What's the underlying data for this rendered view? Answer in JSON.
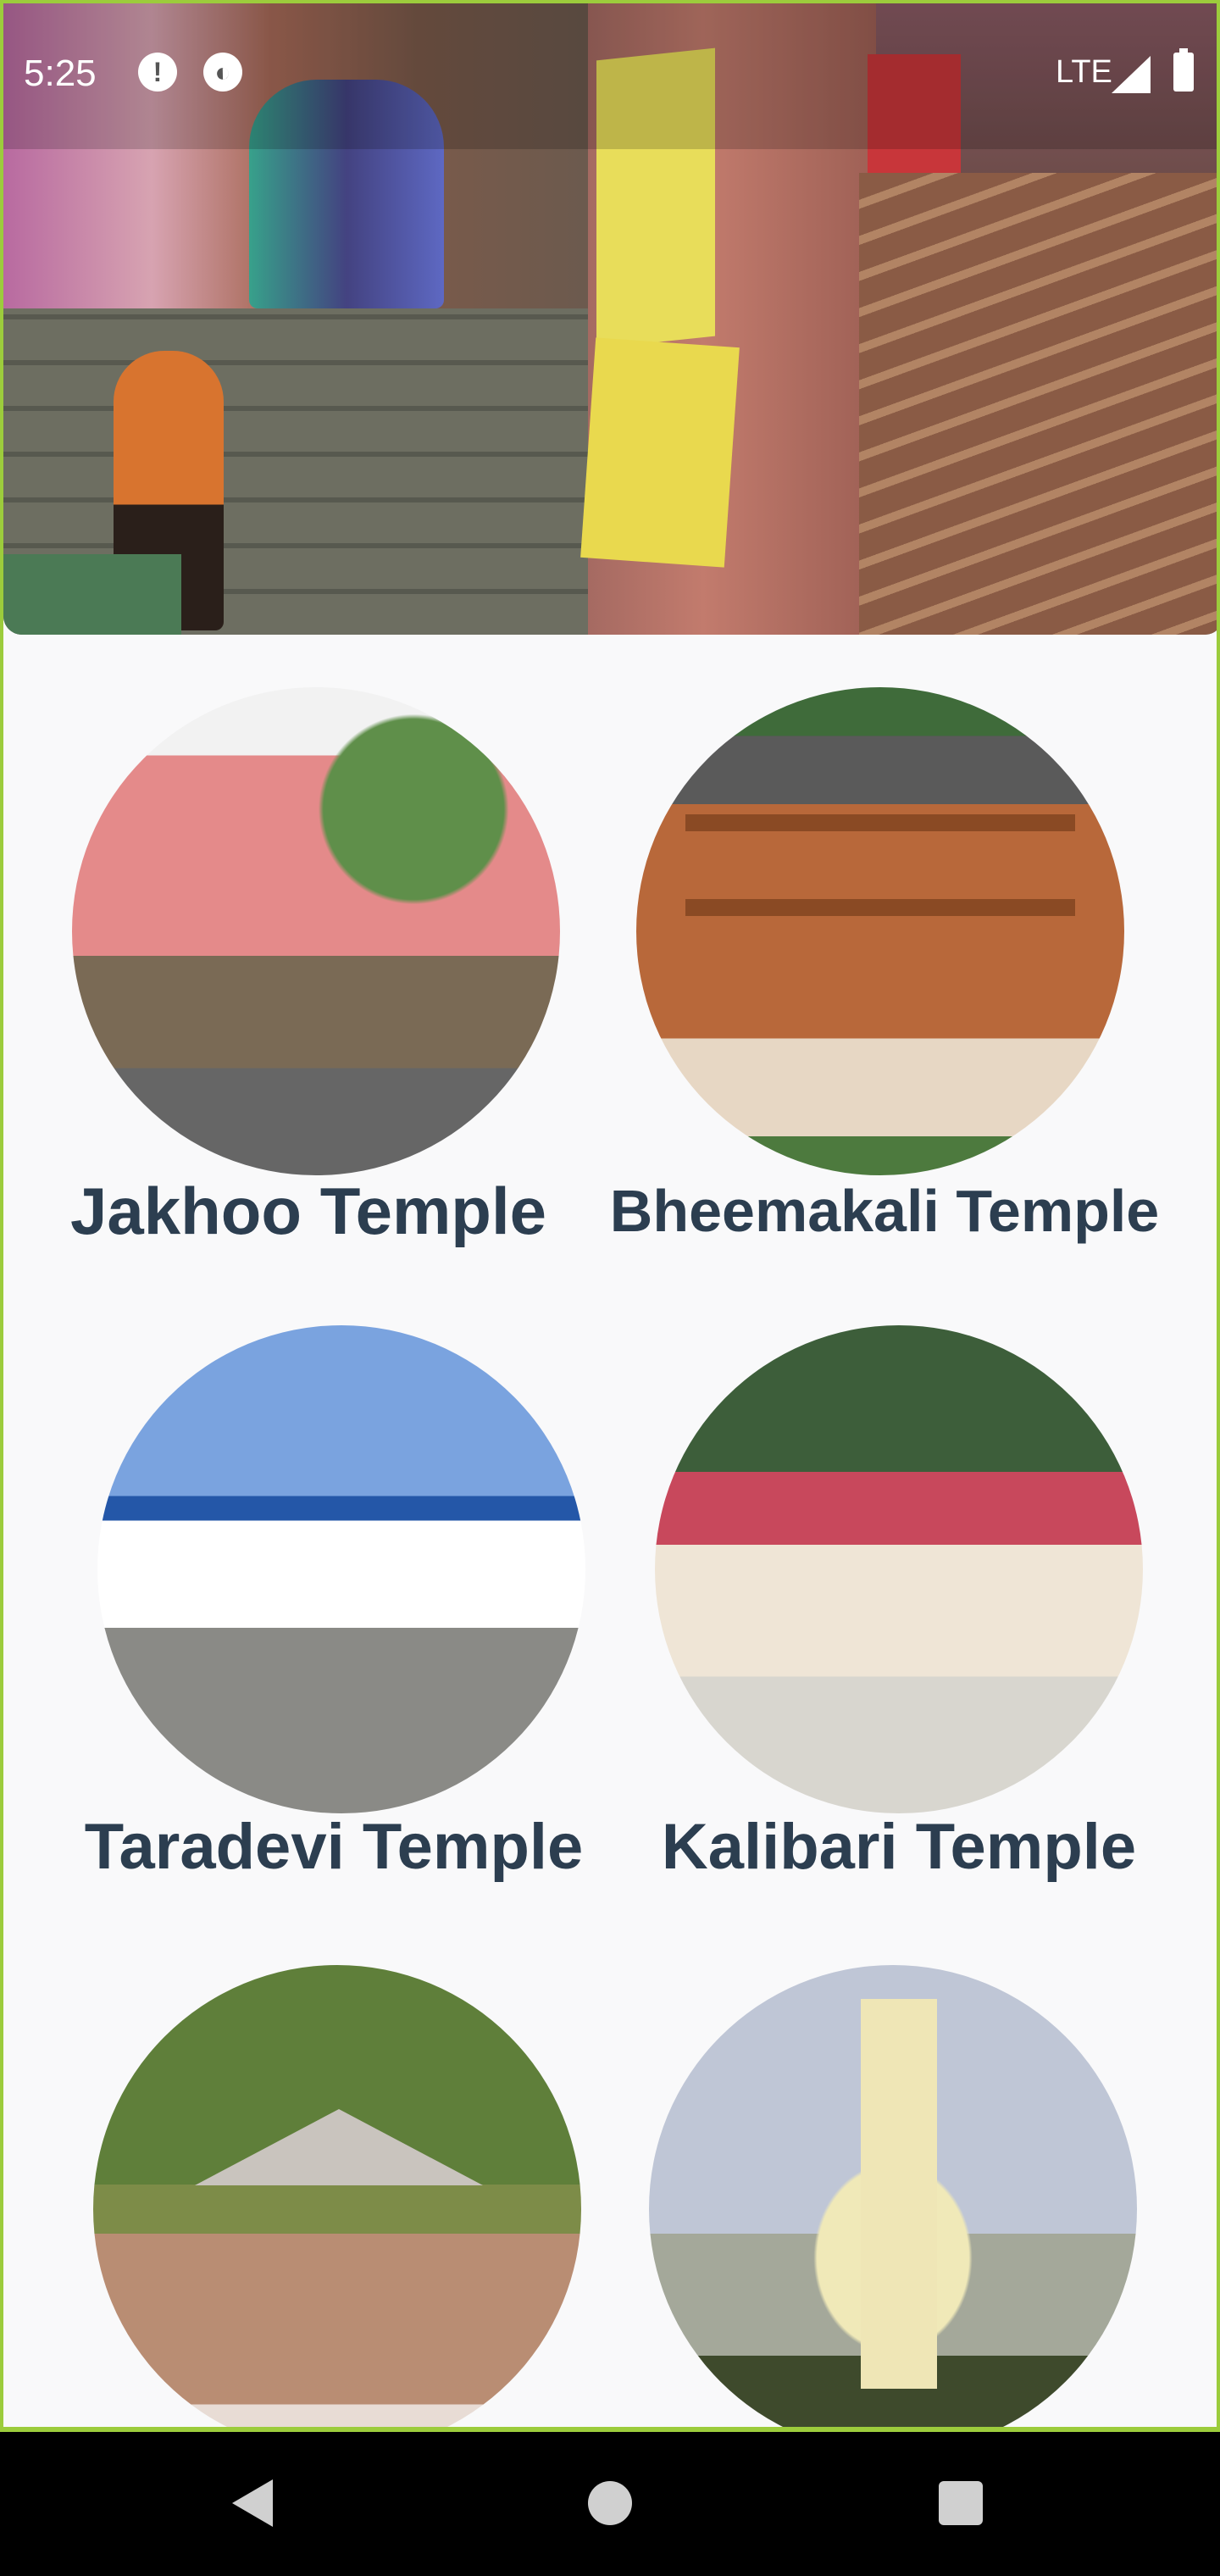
{
  "status_bar": {
    "time": "5:25",
    "network": "LTE",
    "icons": [
      "alert-icon",
      "app-notification-icon",
      "signal-icon",
      "battery-icon"
    ]
  },
  "hero": {
    "image": "jakhoo-temple-hero-photo"
  },
  "temples": [
    {
      "name": "Jakhoo Temple",
      "image": "jakhoo-temple-photo"
    },
    {
      "name": "Bheemakali Temple",
      "image": "bheemakali-temple-photo"
    },
    {
      "name": "Taradevi Temple",
      "image": "taradevi-temple-photo"
    },
    {
      "name": "Kalibari Temple",
      "image": "kalibari-temple-photo"
    },
    {
      "name": "",
      "image": "hatu-temple-photo"
    },
    {
      "name": "",
      "image": "christ-church-photo"
    }
  ],
  "nav_bar": {
    "icons": [
      "back-icon",
      "home-icon",
      "recents-icon"
    ]
  },
  "colors": {
    "title_text": "#2c3e50",
    "frame_border": "#9ccc3c",
    "background": "#f9f9fa"
  }
}
